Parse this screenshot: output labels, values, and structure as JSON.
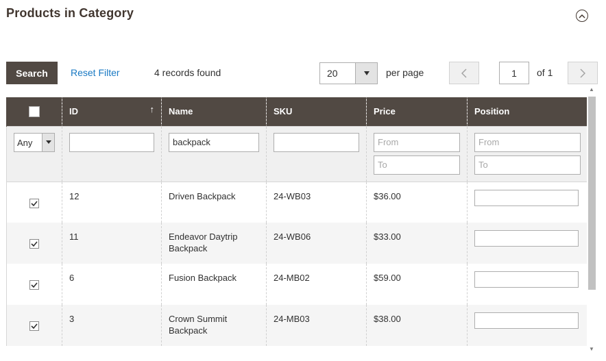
{
  "section": {
    "title": "Products in Category"
  },
  "toolbar": {
    "search_label": "Search",
    "reset_label": "Reset Filter",
    "records_text": "4 records found",
    "per_page_value": "20",
    "per_page_label": "per page",
    "page_value": "1",
    "page_of": "of 1"
  },
  "grid": {
    "columns": [
      "",
      "ID",
      "Name",
      "SKU",
      "Price",
      "Position"
    ],
    "filters": {
      "in_category_value": "Any",
      "id_value": "",
      "name_value": "backpack",
      "sku_value": "",
      "price_from_placeholder": "From",
      "price_to_placeholder": "To",
      "position_from_placeholder": "From",
      "position_to_placeholder": "To"
    },
    "rows": [
      {
        "checked": true,
        "id": "12",
        "name": "Driven Backpack",
        "sku": "24-WB03",
        "price": "$36.00",
        "position": ""
      },
      {
        "checked": true,
        "id": "11",
        "name": "Endeavor Daytrip Backpack",
        "sku": "24-WB06",
        "price": "$33.00",
        "position": ""
      },
      {
        "checked": true,
        "id": "6",
        "name": "Fusion Backpack",
        "sku": "24-MB02",
        "price": "$59.00",
        "position": ""
      },
      {
        "checked": true,
        "id": "3",
        "name": "Crown Summit Backpack",
        "sku": "24-MB03",
        "price": "$38.00",
        "position": ""
      }
    ]
  },
  "colors": {
    "header_bg": "#514943",
    "link": "#1979c3",
    "title": "#41362f"
  },
  "icons": [
    "collapse-up-icon",
    "chevron-down-icon",
    "chevron-left-icon",
    "chevron-right-icon",
    "sort-asc-icon",
    "checkmark-icon"
  ]
}
